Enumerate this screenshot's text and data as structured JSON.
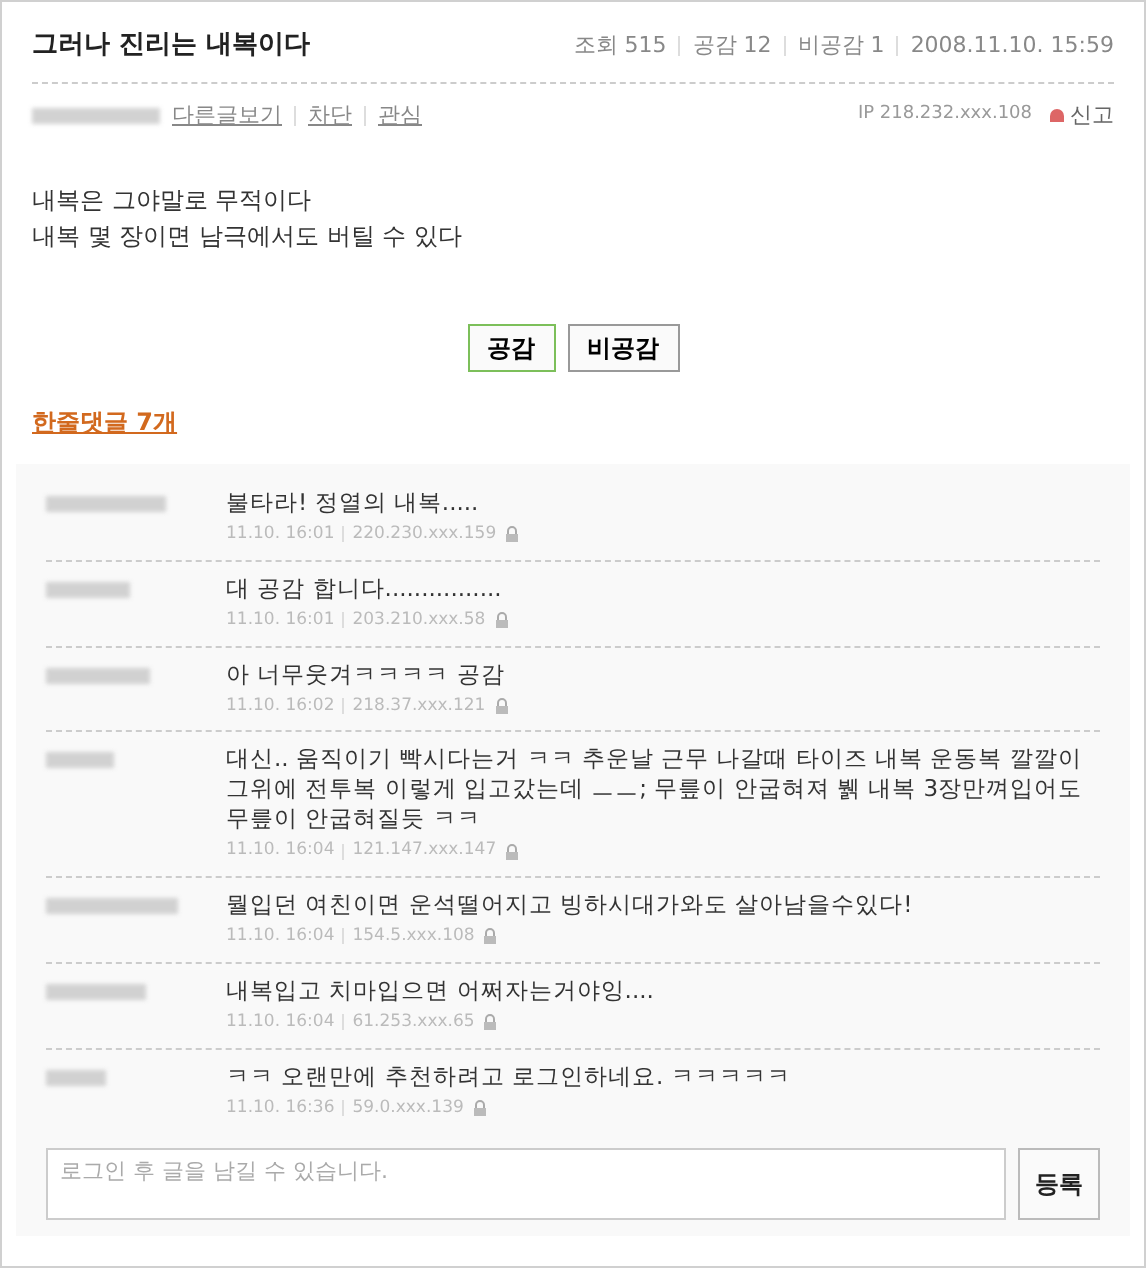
{
  "post": {
    "title": "그러나 진리는 내복이다",
    "stats": [
      "조회 515",
      "공감 12",
      "비공감 1",
      "2008.11.10. 15:59"
    ],
    "author_links": [
      "다른글보기",
      "차단",
      "관심"
    ],
    "ip": "IP 218.232.xxx.108",
    "report": "신고",
    "body": [
      "내복은 그야말로 무적이다",
      "내복 몇 장이면 남극에서도 버틸 수 있다"
    ]
  },
  "votes": [
    {
      "label": "공감",
      "selected": true
    },
    {
      "label": "비공감",
      "selected": false
    }
  ],
  "comments_heading": "한줄댓글 7개",
  "comments": [
    {
      "text": "불타라! 정열의 내복.....",
      "time": "11.10. 16:01",
      "ip": "220.230.xxx.159"
    },
    {
      "text": "대 공감 합니다................",
      "time": "11.10. 16:01",
      "ip": "203.210.xxx.58"
    },
    {
      "text": "아 너무웃겨ㅋㅋㅋㅋ 공감",
      "time": "11.10. 16:02",
      "ip": "218.37.xxx.121"
    },
    {
      "text": "대신.. 움직이기 빡시다는거 ㅋㅋ 추운날 근무 나갈때 타이즈 내복 운동복 깔깔이 그위에 전투복 이렇게 입고갔는데 ㅡㅡ; 무릎이 안굽혀져 뷁 내복 3장만껴입어도 무릎이 안굽혀질듯 ㅋㅋ",
      "time": "11.10. 16:04",
      "ip": "121.147.xxx.147"
    },
    {
      "text": "뭘입던 여친이면 운석떨어지고 빙하시대가와도 살아남을수있다!",
      "time": "11.10. 16:04",
      "ip": "154.5.xxx.108"
    },
    {
      "text": "내복입고 치마입으면 어쩌자는거야잉....",
      "time": "11.10. 16:04",
      "ip": "61.253.xxx.65"
    },
    {
      "text": "ㅋㅋ 오랜만에 추천하려고 로그인하네요. ㅋㅋㅋㅋㅋ",
      "time": "11.10. 16:36",
      "ip": "59.0.xxx.139"
    }
  ],
  "reply": {
    "placeholder": "로그인 후 글을 남길 수 있습니다.",
    "submit": "등록"
  }
}
